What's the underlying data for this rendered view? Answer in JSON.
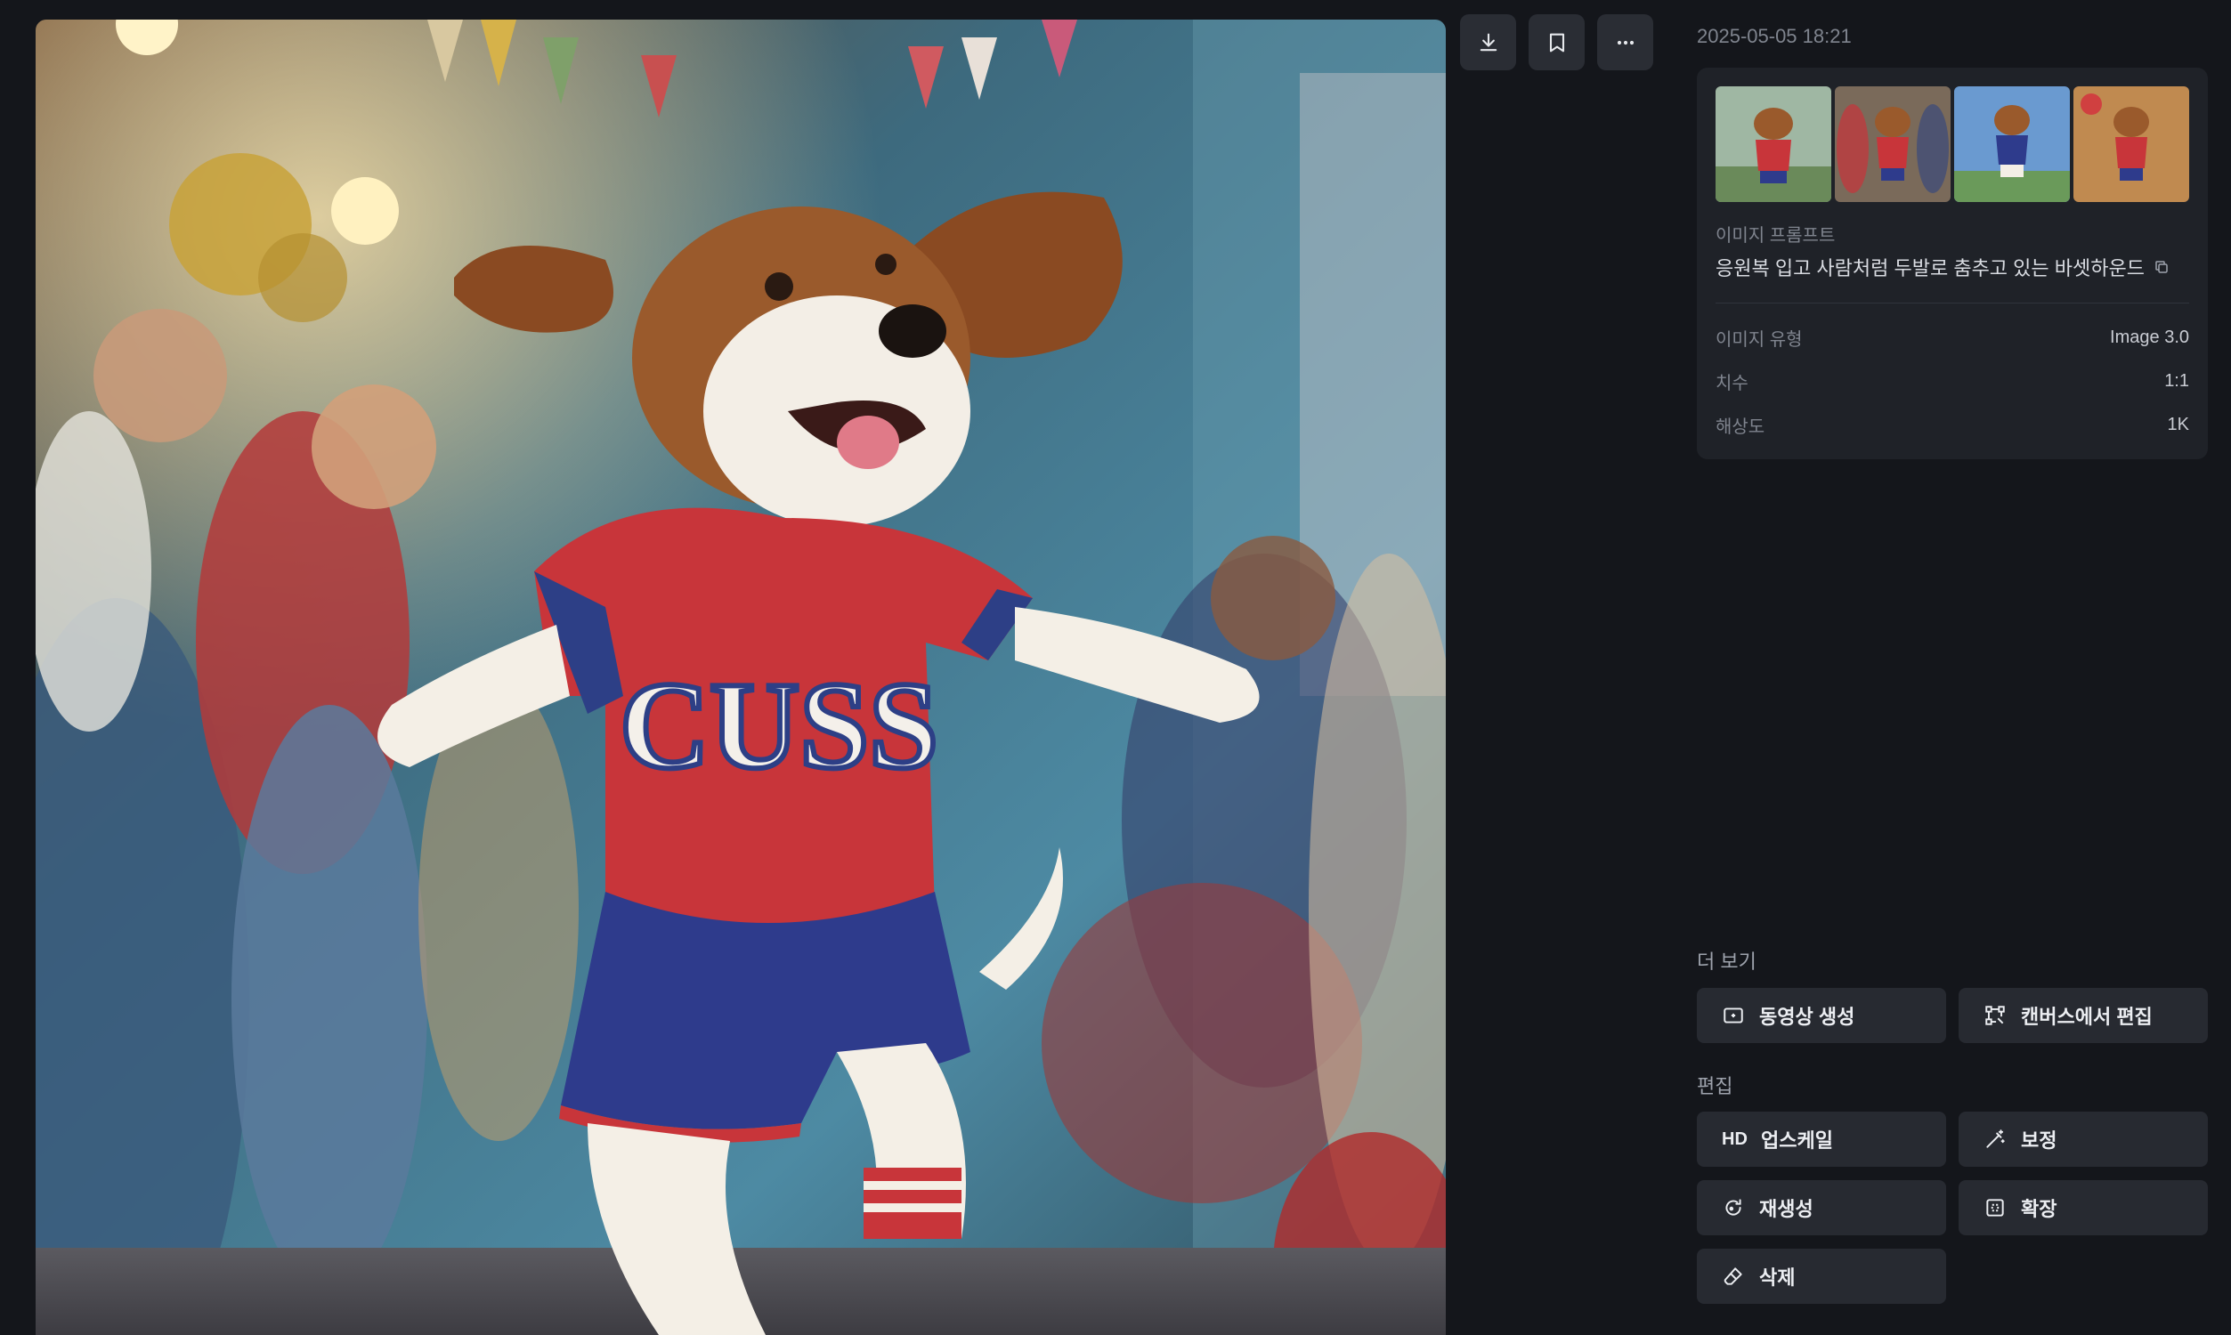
{
  "toolbar": {
    "download_icon": "download-icon",
    "bookmark_icon": "bookmark-icon",
    "more_icon": "more-horizontal-icon"
  },
  "details": {
    "timestamp": "2025-05-05 18:21",
    "prompt_label": "이미지 프롬프트",
    "prompt_text": "응원복 입고 사람처럼 두발로 춤추고 있는 바셋하운드",
    "meta": [
      {
        "key": "이미지 유형",
        "value": "Image 3.0"
      },
      {
        "key": "치수",
        "value": "1:1"
      },
      {
        "key": "해상도",
        "value": "1K"
      }
    ]
  },
  "more_section": {
    "title": "더 보기",
    "actions": [
      {
        "label": "동영상 생성",
        "icon": "video-add-icon"
      },
      {
        "label": "캔버스에서 편집",
        "icon": "canvas-edit-icon"
      }
    ]
  },
  "edit_section": {
    "title": "편집",
    "actions": [
      {
        "label": "업스케일",
        "icon": "hd-icon",
        "glyph": "HD"
      },
      {
        "label": "보정",
        "icon": "magic-wand-icon"
      },
      {
        "label": "재생성",
        "icon": "regenerate-icon"
      },
      {
        "label": "확장",
        "icon": "expand-icon"
      },
      {
        "label": "삭제",
        "icon": "eraser-icon"
      }
    ]
  },
  "main_image": {
    "shirt_text": "CUSS"
  },
  "colors": {
    "background": "#14161b",
    "card": "#1f2228",
    "button": "#272a31"
  }
}
